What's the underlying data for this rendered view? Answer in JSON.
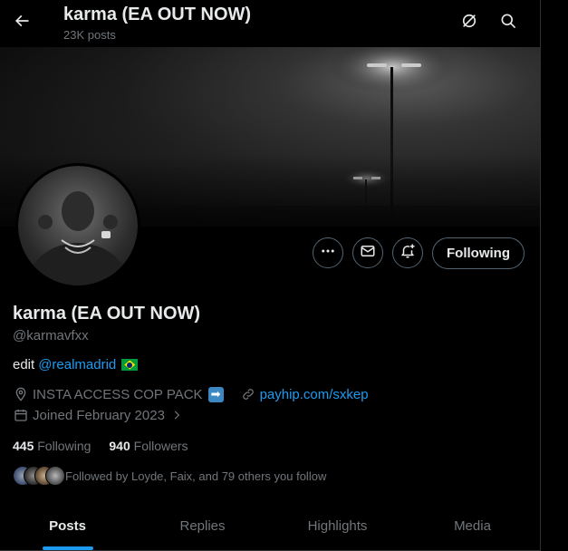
{
  "header": {
    "title": "karma (EA OUT NOW)",
    "post_count": "23K posts",
    "back_icon": "arrow-left-icon",
    "grok_icon": "grok-icon",
    "search_icon": "search-icon"
  },
  "profile": {
    "display_name": "karma (EA OUT NOW)",
    "handle": "@karmavfxx",
    "bio_prefix": "edit",
    "bio_mention": "@realmadrid",
    "bio_flag": "brazil-flag",
    "location": "INSTA ACCESS COP PACK",
    "location_emoji": "right-arrow-emoji",
    "website": "payhip.com/sxkep",
    "joined": "Joined February 2023"
  },
  "actions": {
    "more_icon": "more-icon",
    "message_icon": "mail-icon",
    "notify_icon": "bell-plus-icon",
    "following_label": "Following"
  },
  "stats": {
    "following_count": "445",
    "following_label": "Following",
    "followers_count": "940",
    "followers_label": "Followers"
  },
  "followed_by": {
    "text": "Followed by Loyde, Faix, and 79 others you follow"
  },
  "tabs": [
    {
      "label": "Posts",
      "active": true
    },
    {
      "label": "Replies",
      "active": false
    },
    {
      "label": "Highlights",
      "active": false
    },
    {
      "label": "Media",
      "active": false
    }
  ],
  "colors": {
    "accent": "#1d9bf0",
    "background": "#000000",
    "text_primary": "#e7e9ea",
    "text_secondary": "#71767b",
    "border": "#536471"
  }
}
